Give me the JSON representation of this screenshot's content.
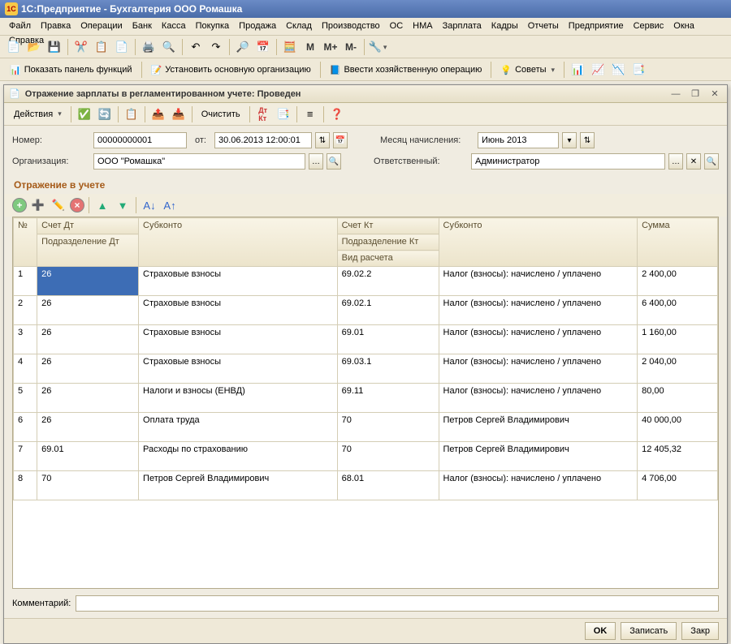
{
  "app": {
    "title": "1С:Предприятие - Бухгалтерия ООО Ромашка",
    "icon_label": "1C"
  },
  "menu": {
    "file": "Файл",
    "edit": "Правка",
    "ops": "Операции",
    "bank": "Банк",
    "cash": "Касса",
    "buy": "Покупка",
    "sell": "Продажа",
    "stock": "Склад",
    "prod": "Производство",
    "os": "ОС",
    "nma": "НМА",
    "salary": "Зарплата",
    "pers": "Кадры",
    "reports": "Отчеты",
    "enterprise": "Предприятие",
    "service": "Сервис",
    "windows": "Окна",
    "help": "Справка"
  },
  "toolbar2": {
    "show_panel": "Показать панель функций",
    "set_org": "Установить основную организацию",
    "enter_op": "Ввести хозяйственную операцию",
    "advice": "Советы"
  },
  "mem": {
    "m": "M",
    "mplus": "M+",
    "mminus": "M-"
  },
  "doc": {
    "title": "Отражение зарплаты в регламентированном учете: Проведен",
    "actions": "Действия",
    "clear": "Очистить",
    "number_label": "Номер:",
    "number": "00000000001",
    "from_label": "от:",
    "date": "30.06.2013 12:00:01",
    "month_label": "Месяц начисления:",
    "month": "Июнь 2013",
    "org_label": "Организация:",
    "org": "ООО \"Ромашка\"",
    "resp_label": "Ответственный:",
    "resp": "Администратор",
    "section": "Отражение в учете",
    "comment_label": "Комментарий:",
    "comment": "",
    "ok": "OK",
    "save": "Записать",
    "close": "Закр"
  },
  "headers": {
    "n": "№",
    "acct_dt": "Счет Дт",
    "subdiv_dt": "Подразделение Дт",
    "subk1": "Субконто",
    "acct_kt": "Счет Кт",
    "subdiv_kt": "Подразделение Кт",
    "calc_type": "Вид расчета",
    "subk2": "Субконто",
    "sum": "Сумма"
  },
  "rows": [
    {
      "n": "1",
      "dt": "26",
      "sk1": "Страховые взносы",
      "kt": "69.02.2",
      "sk2": "Налог (взносы): начислено / уплачено",
      "sum": "2 400,00"
    },
    {
      "n": "2",
      "dt": "26",
      "sk1": "Страховые взносы",
      "kt": "69.02.1",
      "sk2": "Налог (взносы): начислено / уплачено",
      "sum": "6 400,00"
    },
    {
      "n": "3",
      "dt": "26",
      "sk1": "Страховые взносы",
      "kt": "69.01",
      "sk2": "Налог (взносы): начислено / уплачено",
      "sum": "1 160,00"
    },
    {
      "n": "4",
      "dt": "26",
      "sk1": "Страховые взносы",
      "kt": "69.03.1",
      "sk2": "Налог (взносы): начислено / уплачено",
      "sum": "2 040,00"
    },
    {
      "n": "5",
      "dt": "26",
      "sk1": "Налоги и взносы (ЕНВД)",
      "kt": "69.11",
      "sk2": "Налог (взносы): начислено / уплачено",
      "sum": "80,00"
    },
    {
      "n": "6",
      "dt": "26",
      "sk1": "Оплата труда",
      "kt": "70",
      "sk2": "Петров Сергей Владимирович",
      "sum": "40 000,00"
    },
    {
      "n": "7",
      "dt": "69.01",
      "sk1": "Расходы по страхованию",
      "kt": "70",
      "sk2": "Петров Сергей Владимирович",
      "sum": "12 405,32"
    },
    {
      "n": "8",
      "dt": "70",
      "sk1": "Петров Сергей Владимирович",
      "kt": "68.01",
      "sk2": "Налог (взносы): начислено / уплачено",
      "sum": "4 706,00"
    }
  ]
}
